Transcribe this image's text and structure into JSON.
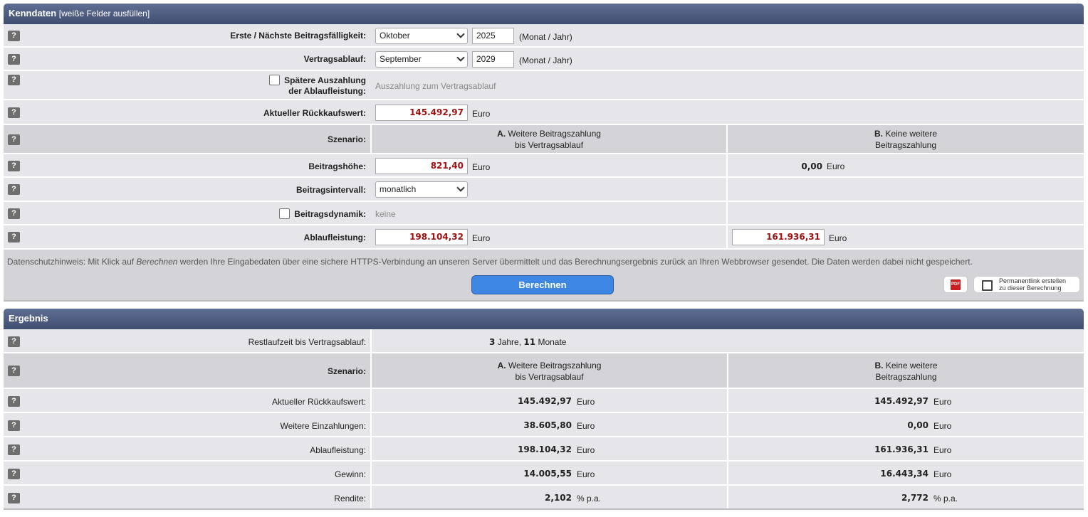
{
  "kenndaten": {
    "title": "Kenndaten",
    "subtitle": "[weiße Felder ausfüllen]",
    "help": "?",
    "faelligkeit": {
      "label": "Erste / Nächste Beitragsfälligkeit:",
      "month": "Oktober",
      "year": "2025",
      "unit": "(Monat / Jahr)"
    },
    "ablauf": {
      "label": "Vertragsablauf:",
      "month": "September",
      "year": "2029",
      "unit": "(Monat / Jahr)"
    },
    "spaetere": {
      "label1": "Spätere Auszahlung",
      "label2": "der Ablaufleistung:",
      "info": "Auszahlung zum Vertragsablauf"
    },
    "rueckkauf": {
      "label": "Aktueller Rückkaufswert:",
      "value": "145.492,97",
      "unit": "Euro"
    },
    "szenario": {
      "label": "Szenario:",
      "a_prefix": "A.",
      "a_line1": "Weitere Beitragszahlung",
      "a_line2": "bis Vertragsablauf",
      "b_prefix": "B.",
      "b_line1": "Keine weitere",
      "b_line2": "Beitragszahlung"
    },
    "beitragshoehe": {
      "label": "Beitragshöhe:",
      "a_value": "821,40",
      "a_unit": "Euro",
      "b_value": "0,00",
      "b_unit": "Euro"
    },
    "intervall": {
      "label": "Beitragsintervall:",
      "value": "monatlich"
    },
    "dynamik": {
      "label": "Beitragsdynamik:",
      "value": "keine"
    },
    "ablaufleistung": {
      "label": "Ablaufleistung:",
      "a_value": "198.104,32",
      "a_unit": "Euro",
      "b_value": "161.936,31",
      "b_unit": "Euro"
    },
    "datenschutz": {
      "pre": "Datenschutzhinweis: Mit Klick auf ",
      "em": "Berechnen",
      "post": " werden Ihre Eingabedaten über eine sichere HTTPS-Verbindung an unseren Server übermittelt und das Berechnungsergebnis zurück an Ihren Webbrowser gesendet. Die Daten werden dabei nicht gespeichert."
    },
    "berechnen": "Berechnen",
    "pdf_label": "PDF",
    "permalink1": "Permanentlink erstellen",
    "permalink2": "zu dieser Berechnung"
  },
  "ergebnis": {
    "title": "Ergebnis",
    "help": "?",
    "restlaufzeit": {
      "label": "Restlaufzeit bis Vertragsablauf:",
      "years": "3",
      "years_unit": "Jahre,",
      "months": "11",
      "months_unit": "Monate"
    },
    "szenario": {
      "label": "Szenario:",
      "a_prefix": "A.",
      "a_line1": "Weitere Beitragszahlung",
      "a_line2": "bis Vertragsablauf",
      "b_prefix": "B.",
      "b_line1": "Keine weitere",
      "b_line2": "Beitragszahlung"
    },
    "rows": [
      {
        "label": "Aktueller Rückkaufswert:",
        "a": "145.492,97",
        "a_unit": "Euro",
        "b": "145.492,97",
        "b_unit": "Euro"
      },
      {
        "label": "Weitere Einzahlungen:",
        "a": "38.605,80",
        "a_unit": "Euro",
        "b": "0,00",
        "b_unit": "Euro"
      },
      {
        "label": "Ablaufleistung:",
        "a": "198.104,32",
        "a_unit": "Euro",
        "b": "161.936,31",
        "b_unit": "Euro"
      },
      {
        "label": "Gewinn:",
        "a": "14.005,55",
        "a_unit": "Euro",
        "b": "16.443,34",
        "b_unit": "Euro"
      },
      {
        "label": "Rendite:",
        "a": "2,102",
        "a_unit": "% p.a.",
        "b": "2,772",
        "b_unit": "% p.a."
      }
    ]
  }
}
